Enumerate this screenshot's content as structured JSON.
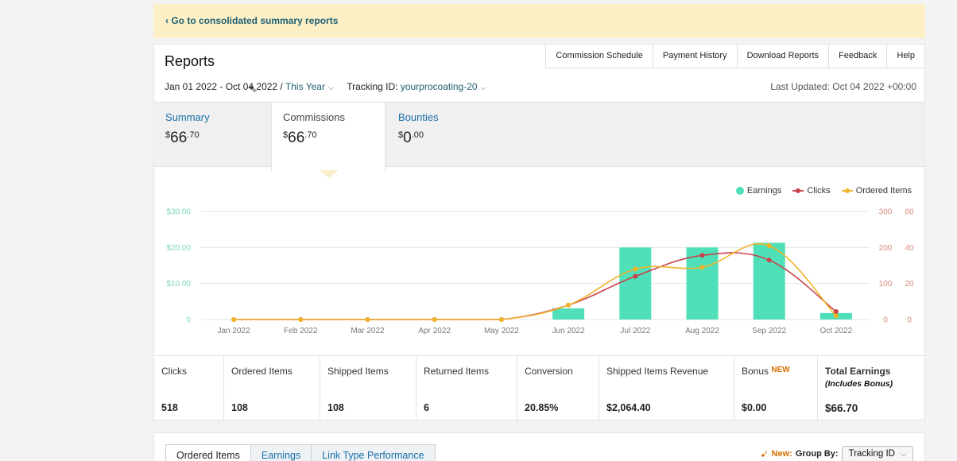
{
  "banner": {
    "link": "‹ Go to consolidated summary reports"
  },
  "header": {
    "title": "Reports",
    "nav": [
      "Commission Schedule",
      "Payment History",
      "Download Reports",
      "Feedback",
      "Help"
    ],
    "date_range": "Jan 01 2022 - Oct 04 2022 /",
    "period": "This Year",
    "tracking_label": "Tracking ID:",
    "tracking_id": "yourprocoating-20",
    "last_updated": "Last Updated: Oct 04 2022 +00:00"
  },
  "tabs": [
    {
      "label": "Summary",
      "whole": "66",
      "cents": ".70"
    },
    {
      "label": "Commissions",
      "whole": "66",
      "cents": ".70"
    },
    {
      "label": "Bounties",
      "whole": "0",
      "cents": ".00"
    }
  ],
  "currency_symbol": "$",
  "legend": {
    "earnings": "Earnings",
    "clicks": "Clicks",
    "ordered": "Ordered Items"
  },
  "colors": {
    "earnings": "#4fe0b9",
    "clicks": "#c9424a",
    "ordered": "#f1b32a",
    "link": "#1a6fa7",
    "banner": "#fdf0c6"
  },
  "chart_data": {
    "type": "bar",
    "categories": [
      "Jan 2022",
      "Feb 2022",
      "Mar 2022",
      "Apr 2022",
      "May 2022",
      "Jun 2022",
      "Jul 2022",
      "Aug 2022",
      "Sep 2022",
      "Oct 2022"
    ],
    "series": [
      {
        "name": "Earnings",
        "type": "bar",
        "axis": "left",
        "values": [
          0,
          0,
          0,
          0,
          0,
          3.1,
          20.0,
          20.0,
          21.3,
          1.8
        ]
      },
      {
        "name": "Clicks",
        "type": "line",
        "axis": "right1",
        "values": [
          0,
          0,
          0,
          0,
          0,
          40,
          120,
          178,
          165,
          22
        ]
      },
      {
        "name": "Ordered Items",
        "type": "line",
        "axis": "right2",
        "values": [
          0,
          0,
          0,
          0,
          0,
          8,
          28,
          29,
          41,
          2
        ]
      }
    ],
    "y_left": {
      "ticks": [
        "$30.00",
        "$20.00",
        "$10.00",
        "0"
      ],
      "ylim": [
        0,
        30
      ]
    },
    "y_right1": {
      "ticks": [
        "300",
        "200",
        "100",
        "0"
      ],
      "ylim": [
        0,
        300
      ]
    },
    "y_right2": {
      "ticks": [
        "60",
        "40",
        "20",
        "0"
      ],
      "ylim": [
        0,
        60
      ]
    },
    "grid": true,
    "legend_position": "top-right"
  },
  "metrics": [
    {
      "label": "Clicks",
      "value": "518"
    },
    {
      "label": "Ordered Items",
      "value": "108"
    },
    {
      "label": "Shipped Items",
      "value": "108"
    },
    {
      "label": "Returned Items",
      "value": "6"
    },
    {
      "label": "Conversion",
      "value": "20.85%"
    },
    {
      "label": "Shipped Items Revenue",
      "value": "$2,064.40"
    },
    {
      "label": "Bonus",
      "badge": "NEW",
      "value": "$0.00"
    },
    {
      "label": "Total Earnings",
      "sub": "(Includes Bonus)",
      "value": "$66.70"
    }
  ],
  "bottom": {
    "tabs": [
      "Ordered Items",
      "Earnings",
      "Link Type Performance"
    ],
    "new_label": "New:",
    "group_by": "Group By:",
    "group_value": "Tracking ID"
  }
}
